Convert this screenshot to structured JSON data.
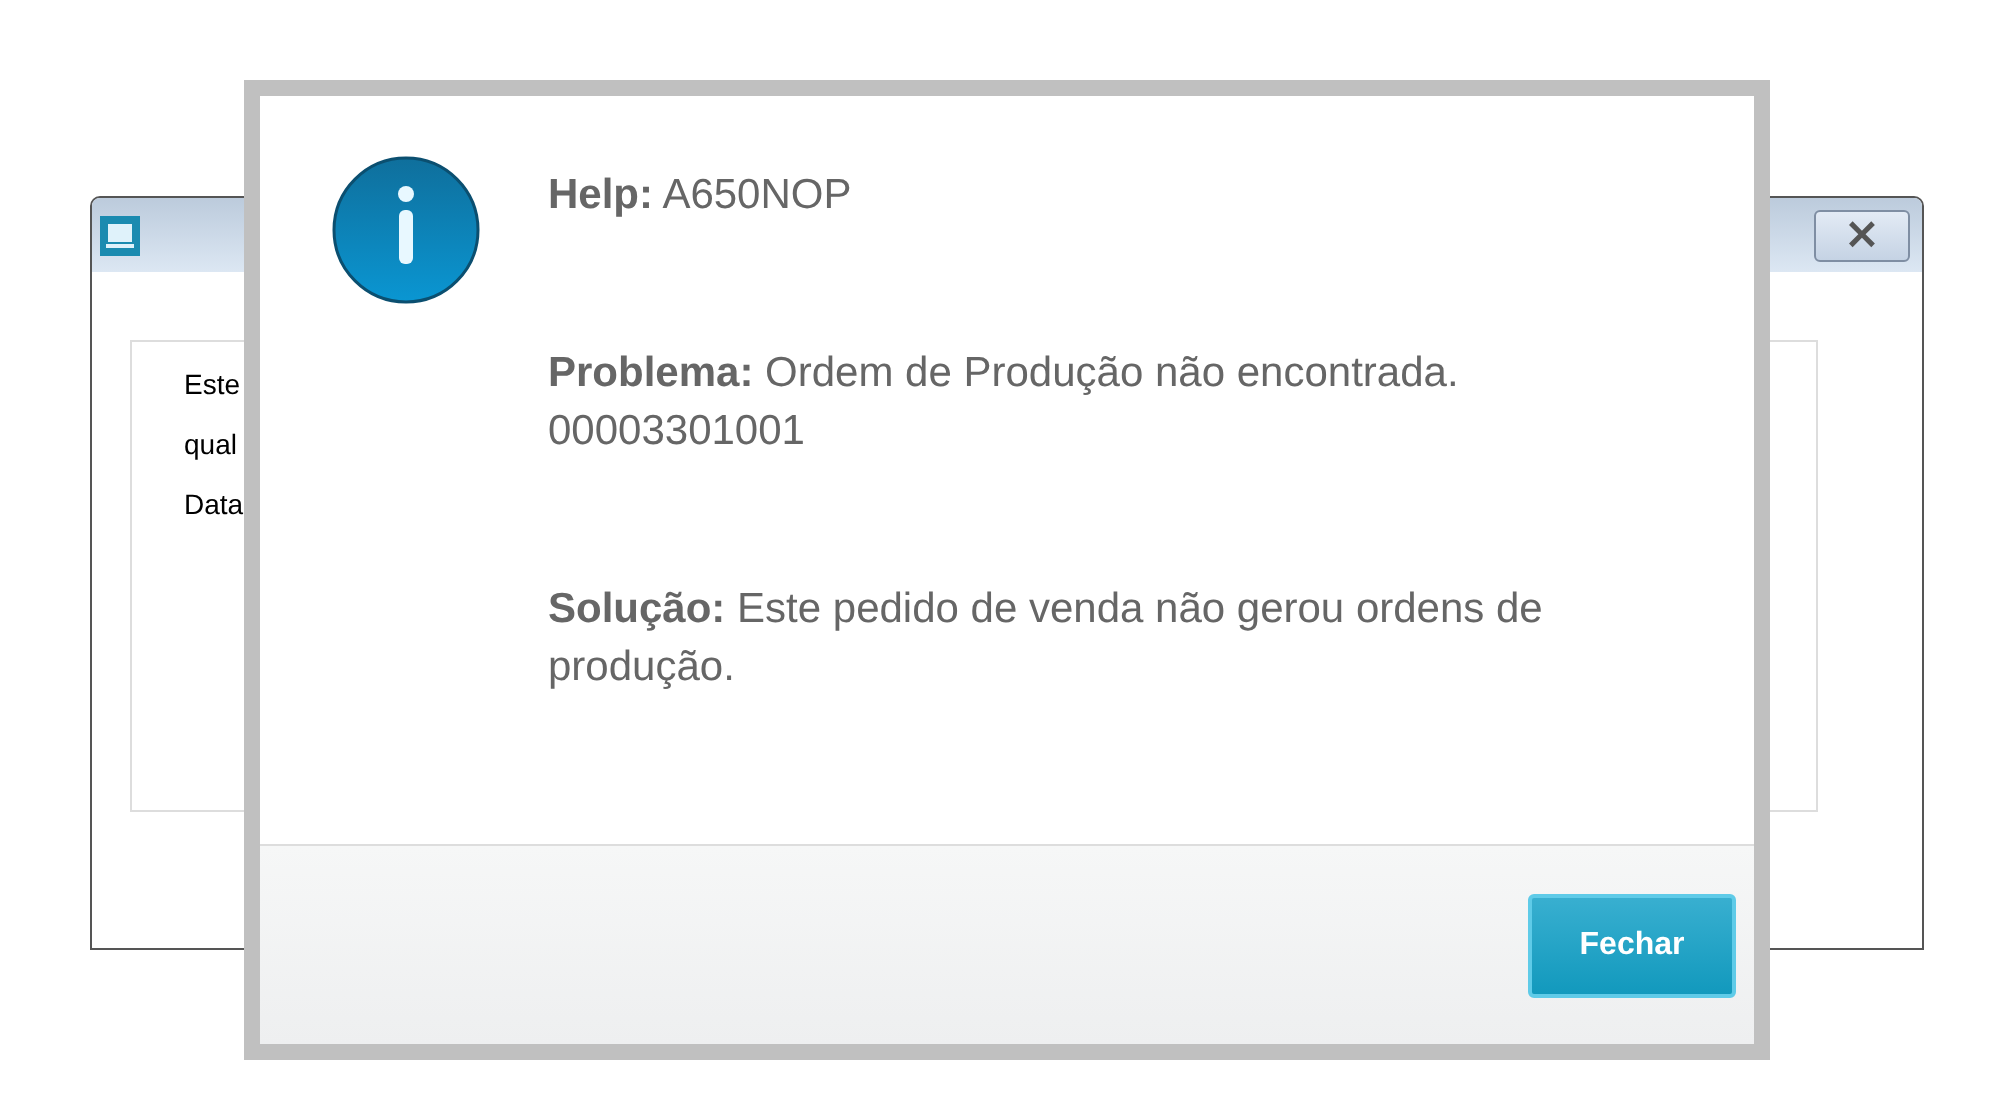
{
  "background_window": {
    "close_button": {
      "label": "×"
    },
    "lines": [
      "Este",
      "qual",
      "Data"
    ]
  },
  "dialog": {
    "fields": [
      {
        "label": "Help:",
        "value": "A650NOP"
      },
      {
        "label": "Problema:",
        "value": "Ordem de Produção não encontrada. 00003301001"
      },
      {
        "label": "Solução:",
        "value": "Este pedido de venda não gerou ordens de produção."
      }
    ],
    "buttons": [
      "Fechar"
    ]
  }
}
